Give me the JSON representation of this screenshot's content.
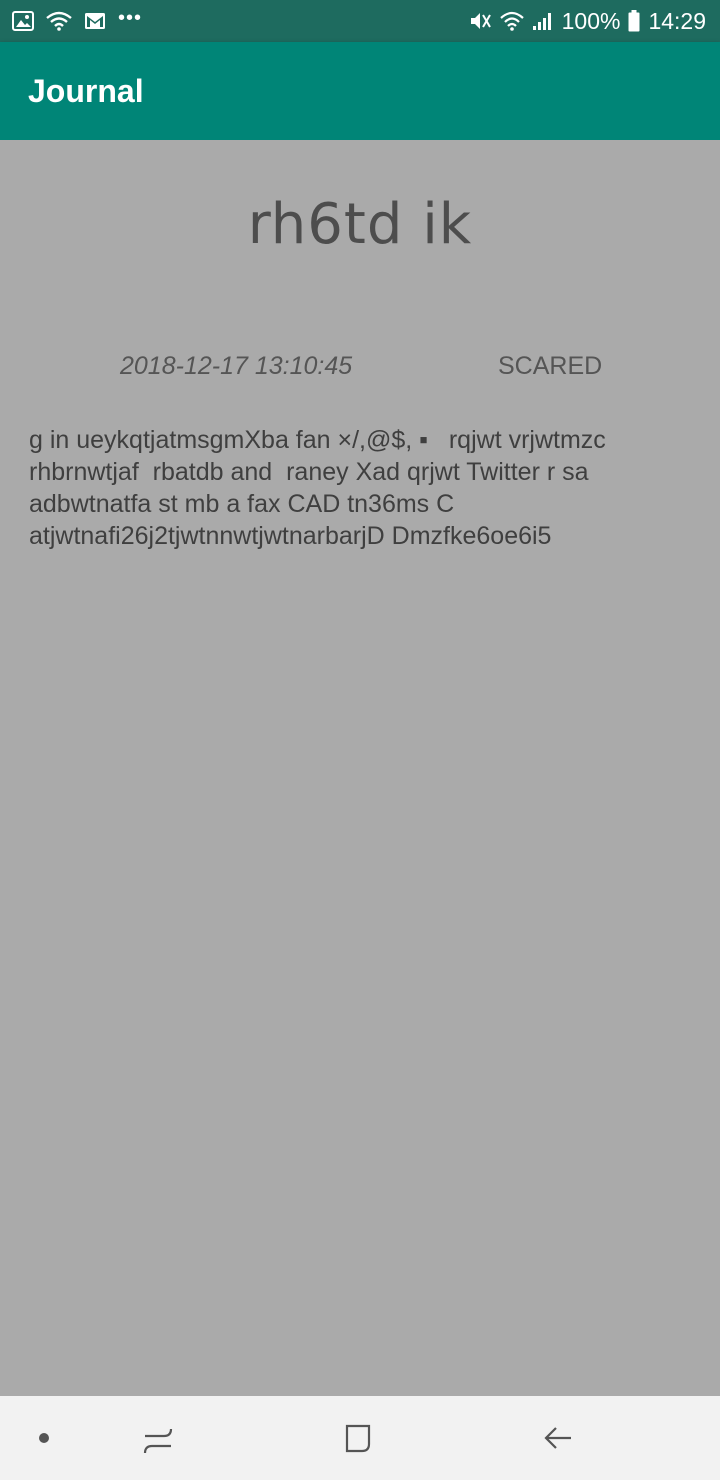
{
  "status_bar": {
    "battery": "100%",
    "time": "14:29",
    "more_dots": "•••"
  },
  "app_bar": {
    "title": "Journal"
  },
  "entry": {
    "title": "rh6td ik",
    "date": "2018-12-17 13:10:45",
    "mood": "SCARED",
    "body": "g in ueykqtjatmsgmXba fan ×/,@$, ▪   rqjwt vrjwtmzc rhbrnwtjaf  rbatdb and  raney Xad qrjwt Twitter r sa adbwtnatfa st mb a fax CAD tn36ms C atjwtnafi26j2tjwtnnwtjwtnarbarjD Dmzfke6oe6i5"
  },
  "nav_bar": {
    "icons": [
      "dot-icon",
      "recent-apps-icon",
      "home-icon",
      "back-icon"
    ]
  },
  "colors": {
    "status_bar": "#1e6b5f",
    "app_bar": "#008577",
    "background": "#aaaaaa",
    "nav_bar": "#f2f2f2"
  }
}
